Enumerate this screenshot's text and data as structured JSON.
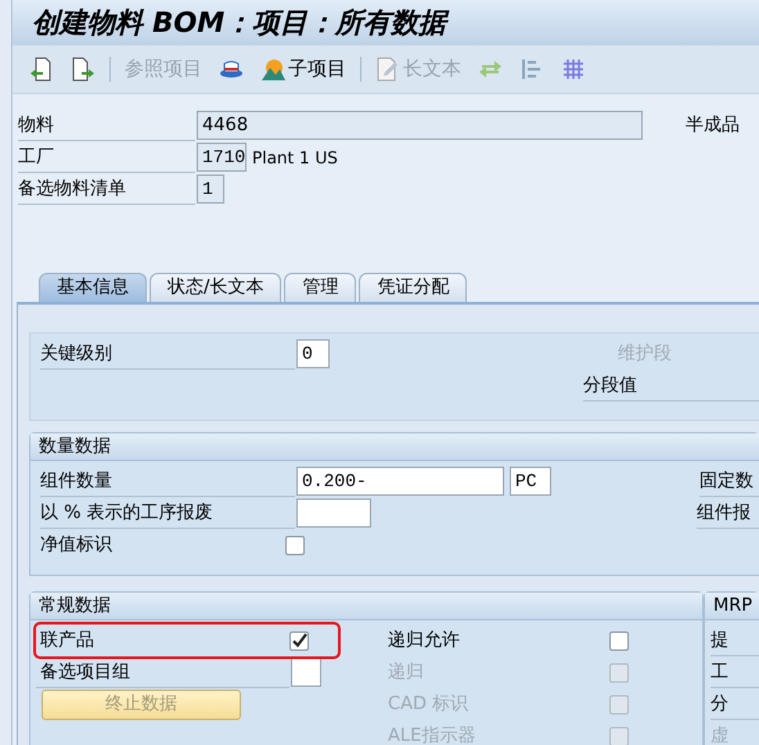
{
  "title": "创建物料 BOM：项目：所有数据",
  "toolbar": [
    {
      "kind": "prev"
    },
    {
      "kind": "next"
    },
    {
      "kind": "sep"
    },
    {
      "kind": "text",
      "label": "参照项目",
      "disabled": true
    },
    {
      "kind": "hat"
    },
    {
      "kind": "mountain",
      "label": "子项目",
      "disabled": false
    },
    {
      "kind": "sep"
    },
    {
      "kind": "pencil",
      "label": "长文本",
      "disabled": true
    },
    {
      "kind": "swap"
    },
    {
      "kind": "align"
    },
    {
      "kind": "grid"
    }
  ],
  "header": {
    "fields": [
      {
        "label": "物料",
        "value": "4468"
      },
      {
        "label": "工厂",
        "value": "1710",
        "note": "Plant 1 US"
      },
      {
        "label": "备选物料清单",
        "value": "1"
      }
    ],
    "right_label": "半成品"
  },
  "tabs": [
    {
      "label": "基本信息",
      "selected": true
    },
    {
      "label": "状态/长文本",
      "selected": false
    },
    {
      "label": "管理",
      "selected": false
    },
    {
      "label": "凭证分配",
      "selected": false
    }
  ],
  "basic": {
    "key_level": {
      "label": "关键级别",
      "value": "0"
    },
    "maintenance_label": "维护段",
    "segment_label": "分段值"
  },
  "quantity": {
    "title": "数量数据",
    "rows": [
      {
        "kind": "qty",
        "label": "组件数量",
        "value": "0.200-",
        "unit": "PC"
      },
      {
        "kind": "field",
        "label": "以 % 表示的工序报废"
      },
      {
        "kind": "check",
        "label": "净值标识",
        "checked": false
      }
    ],
    "right_labels": [
      "固定数",
      "组件报"
    ]
  },
  "general": {
    "title": "常规数据",
    "left": [
      {
        "kind": "check",
        "label": "联产品",
        "checked": true,
        "highlighted": true
      },
      {
        "kind": "field",
        "label": "备选项目组",
        "highlighted": false
      },
      {
        "kind": "button",
        "label": "终止数据",
        "disabled": true
      }
    ],
    "right": [
      {
        "label": "递归允许",
        "checked": false,
        "disabled": false
      },
      {
        "label": "递归",
        "checked": false,
        "disabled": true
      },
      {
        "label": "CAD 标识",
        "checked": false,
        "disabled": true
      },
      {
        "label": "ALE指示器",
        "checked": false,
        "disabled": true
      }
    ]
  },
  "mrp": {
    "title": "MRP",
    "rows": [
      {
        "label": "提",
        "disabled": false
      },
      {
        "label": "工",
        "disabled": false
      },
      {
        "label": "分",
        "disabled": false
      },
      {
        "label": "虚",
        "disabled": true
      }
    ]
  }
}
